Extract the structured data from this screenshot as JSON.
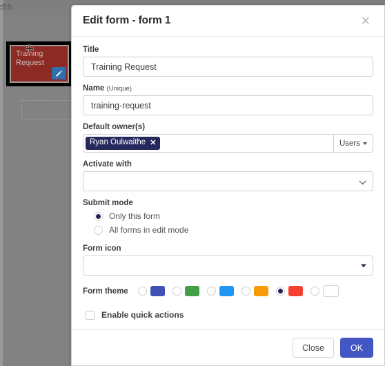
{
  "background": {
    "heading": "cess",
    "card": {
      "title": "Training Request",
      "edit_icon": "pencil-icon",
      "color": "#8e2a24",
      "edit_button_color": "#2f6fad"
    },
    "cursor_icon": "move-cursor-icon"
  },
  "modal": {
    "title": "Edit form - form 1",
    "close_icon": "close-icon",
    "fields": {
      "title": {
        "label": "Title",
        "value": "Training Request",
        "placeholder": ""
      },
      "name": {
        "label": "Name",
        "label_suffix": "(Unique)",
        "value": "training-request",
        "placeholder": ""
      },
      "default_owners": {
        "label": "Default owner(s)",
        "tokens": [
          {
            "name": "Ryan Oulwaithe",
            "remove_icon": "close-icon",
            "color": "#26295c"
          }
        ],
        "type_button_label": "Users",
        "type_button_icon": "chevron-down-icon"
      },
      "activate_with": {
        "label": "Activate with",
        "value": "",
        "icon": "chevron-down-icon"
      },
      "submit_mode": {
        "label": "Submit mode",
        "options": [
          {
            "label": "Only this form",
            "selected": true
          },
          {
            "label": "All forms in edit mode",
            "selected": false
          }
        ]
      },
      "form_icon": {
        "label": "Form icon",
        "value": "",
        "icon": "caret-down-icon"
      },
      "form_theme": {
        "label": "Form theme",
        "swatches": [
          {
            "color": "#3f51b5",
            "selected": false
          },
          {
            "color": "#43a047",
            "selected": false
          },
          {
            "color": "#2196f3",
            "selected": false
          },
          {
            "color": "#f99a09",
            "selected": false
          },
          {
            "color": "#f4402f",
            "selected": true
          },
          {
            "color": "#ffffff",
            "selected": false
          }
        ]
      },
      "quick_actions": {
        "label": "Enable quick actions",
        "checked": false
      }
    },
    "footer": {
      "close_label": "Close",
      "ok_label": "OK",
      "ok_color": "#4257c4"
    }
  }
}
